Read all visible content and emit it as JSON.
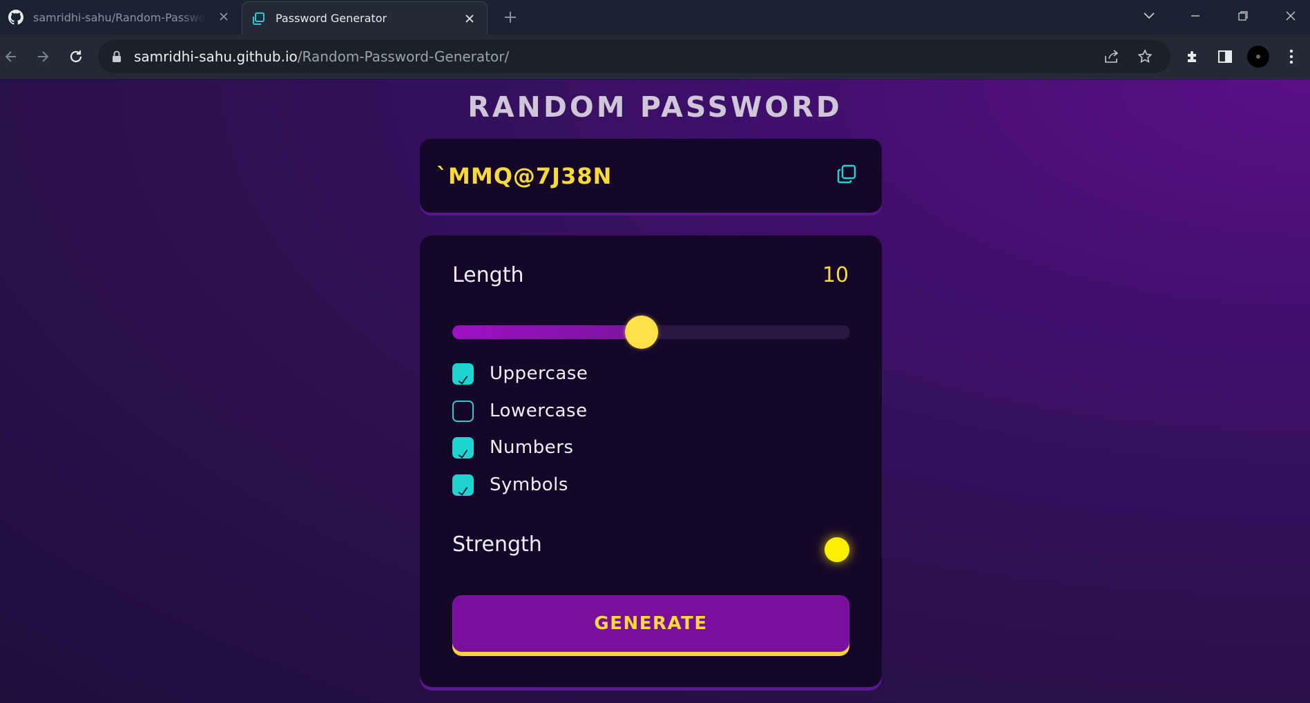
{
  "browser": {
    "tabs": [
      {
        "title": "samridhi-sahu/Random-Password-G",
        "icon": "github-icon",
        "active": false
      },
      {
        "title": "Password Generator",
        "icon": "tab-copy-icon",
        "active": true
      }
    ],
    "url_host": "samridhi-sahu.github.io",
    "url_path": "/Random-Password-Generator/"
  },
  "app": {
    "title": "RANDOM PASSWORD",
    "password": "`MMQ@7J38N",
    "length_label": "Length",
    "length_value": "10",
    "length_fraction": 0.475,
    "options": [
      {
        "label": "Uppercase",
        "checked": true
      },
      {
        "label": "Lowercase",
        "checked": false
      },
      {
        "label": "Numbers",
        "checked": true
      },
      {
        "label": "Symbols",
        "checked": true
      }
    ],
    "strength_label": "Strength",
    "strength_color": "#ffee00",
    "generate_label": "GENERATE"
  },
  "colors": {
    "accent_yellow": "#f8d93a",
    "accent_cyan": "#20d3d3",
    "card_bg": "#150728",
    "button_purple": "#7a0f9e"
  }
}
